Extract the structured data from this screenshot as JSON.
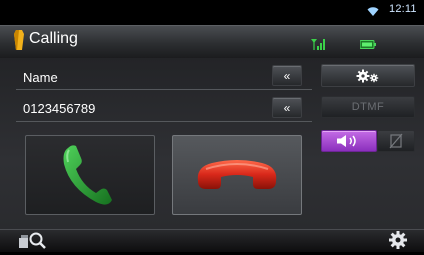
{
  "status_bar": {
    "time": "12:11",
    "icons": [
      "wifi-icon"
    ]
  },
  "header": {
    "title": "Calling",
    "icons": [
      "phone-tab-icon",
      "signal-icon",
      "battery-icon"
    ],
    "accent": "#f0b020"
  },
  "call": {
    "name": "Name",
    "number": "0123456789"
  },
  "buttons": {
    "rewind_label": "«",
    "dtmf_label": "DTMF",
    "icons": [
      "gear-icon",
      "speaker-icon",
      "mute-icon",
      "accept-call-icon",
      "end-call-icon",
      "search-icon",
      "settings-icon"
    ]
  },
  "colors": {
    "speaker_active": "#b04ad8",
    "accept": "#2f9a3a",
    "reject": "#d42a1a"
  }
}
